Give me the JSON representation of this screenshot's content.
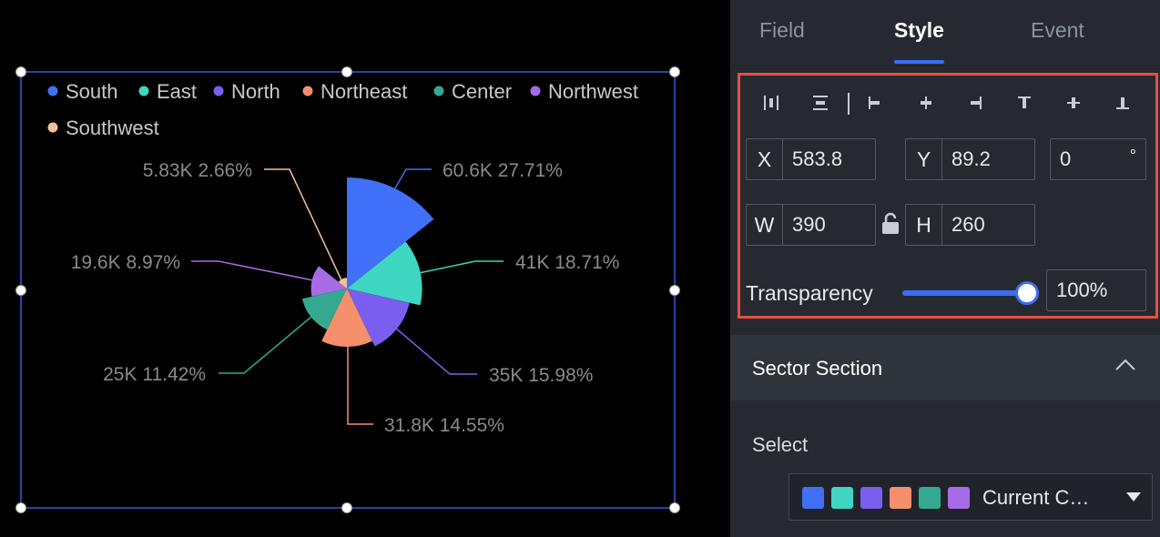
{
  "chart_data": {
    "type": "rose",
    "legend_position": "top-left",
    "series": [
      {
        "name": "South",
        "value": 60.6,
        "value_label": "60.6K",
        "percent": "27.71%",
        "color": "#4070f7"
      },
      {
        "name": "East",
        "value": 41,
        "value_label": "41K",
        "percent": "18.71%",
        "color": "#3fd6c1"
      },
      {
        "name": "North",
        "value": 35,
        "value_label": "35K",
        "percent": "15.98%",
        "color": "#7a5ef0"
      },
      {
        "name": "Northeast",
        "value": 31.8,
        "value_label": "31.8K",
        "percent": "14.55%",
        "color": "#f68f6c"
      },
      {
        "name": "Center",
        "value": 25,
        "value_label": "25K",
        "percent": "11.42%",
        "color": "#34a891"
      },
      {
        "name": "Northwest",
        "value": 19.6,
        "value_label": "19.6K",
        "percent": "8.97%",
        "color": "#a86be6"
      },
      {
        "name": "Southwest",
        "value": 5.83,
        "value_label": "5.83K",
        "percent": "2.66%",
        "color": "#f2c09a"
      }
    ]
  },
  "panel": {
    "tabs": [
      {
        "label": "Field",
        "active": false
      },
      {
        "label": "Style",
        "active": true
      },
      {
        "label": "Event",
        "active": false
      }
    ],
    "position": {
      "x_label": "X",
      "x_value": "583.8",
      "y_label": "Y",
      "y_value": "89.2",
      "rotation_value": "0",
      "rotation_unit": "°",
      "w_label": "W",
      "w_value": "390",
      "h_label": "H",
      "h_value": "260",
      "transparency_label": "Transparency",
      "transparency_value": "100%",
      "transparency_level": 1.0
    },
    "sector_section": {
      "title": "Sector Section",
      "select_label": "Select",
      "select_value": "Current C…",
      "swatches": [
        "#4070f7",
        "#3fd6c1",
        "#7a5ef0",
        "#f68f6c",
        "#34a891",
        "#a86be6"
      ]
    }
  },
  "colors": {
    "accent": "#3b6cf6",
    "highlight_border": "#e2503f",
    "panel_bg": "#262a30",
    "selection_border": "#3a5bd9"
  }
}
